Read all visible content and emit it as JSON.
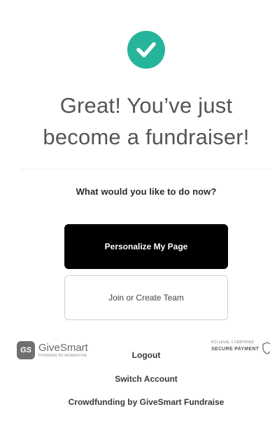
{
  "success": {
    "icon": "checkmark-circle-icon",
    "accent_color": "#26b59b",
    "headline_line1": "Great! You’ve just",
    "headline_line2": "become a fundraiser!"
  },
  "prompt": "What would you like to do now?",
  "actions": {
    "personalize_label": "Personalize My Page",
    "team_label": "Join or Create Team"
  },
  "footer": {
    "brand_mark": "GS",
    "brand_name": "GiveSmart",
    "brand_tagline": "POWERED BY MOMENTIVE",
    "pci_line1": "PCI LEVEL 1 CERTIFIED",
    "pci_line2": "SECURE PAYMENT",
    "logout_label": "Logout",
    "switch_account_label": "Switch Account",
    "crowdfunding_label": "Crowdfunding by GiveSmart Fundraise"
  }
}
